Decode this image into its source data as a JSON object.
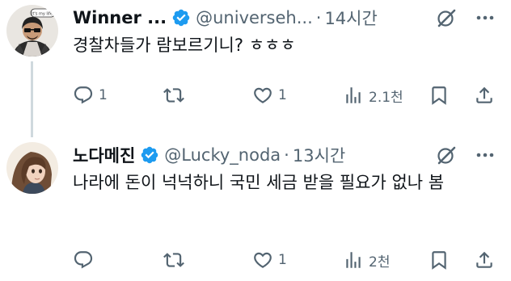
{
  "tweets": [
    {
      "display_name": "Winner ...",
      "handle": "@universeh...",
      "separator": "·",
      "time": "14시간",
      "text": "경찰차들가 람보르기니? ㅎㅎㅎ",
      "avatar_badge": "It's my life!",
      "stats": {
        "replies": "1",
        "retweets": "",
        "likes": "1",
        "views": "2.1천"
      }
    },
    {
      "display_name": "노다메진",
      "handle": "@Lucky_noda",
      "separator": "·",
      "time": "13시간",
      "text": "나라에 돈이 넉넉하니 국민 세금 받을 필요가 없나 봄",
      "stats": {
        "replies": "",
        "retweets": "",
        "likes": "1",
        "views": "2천"
      }
    }
  ],
  "colors": {
    "text": "#0f1419",
    "secondary": "#536471",
    "verified": "#1d9bf0",
    "thread_line": "#cfd9de"
  },
  "icons": [
    "verified-badge-icon",
    "grok-icon",
    "more-icon",
    "reply-icon",
    "retweet-icon",
    "like-icon",
    "views-icon",
    "bookmark-icon",
    "share-icon"
  ]
}
